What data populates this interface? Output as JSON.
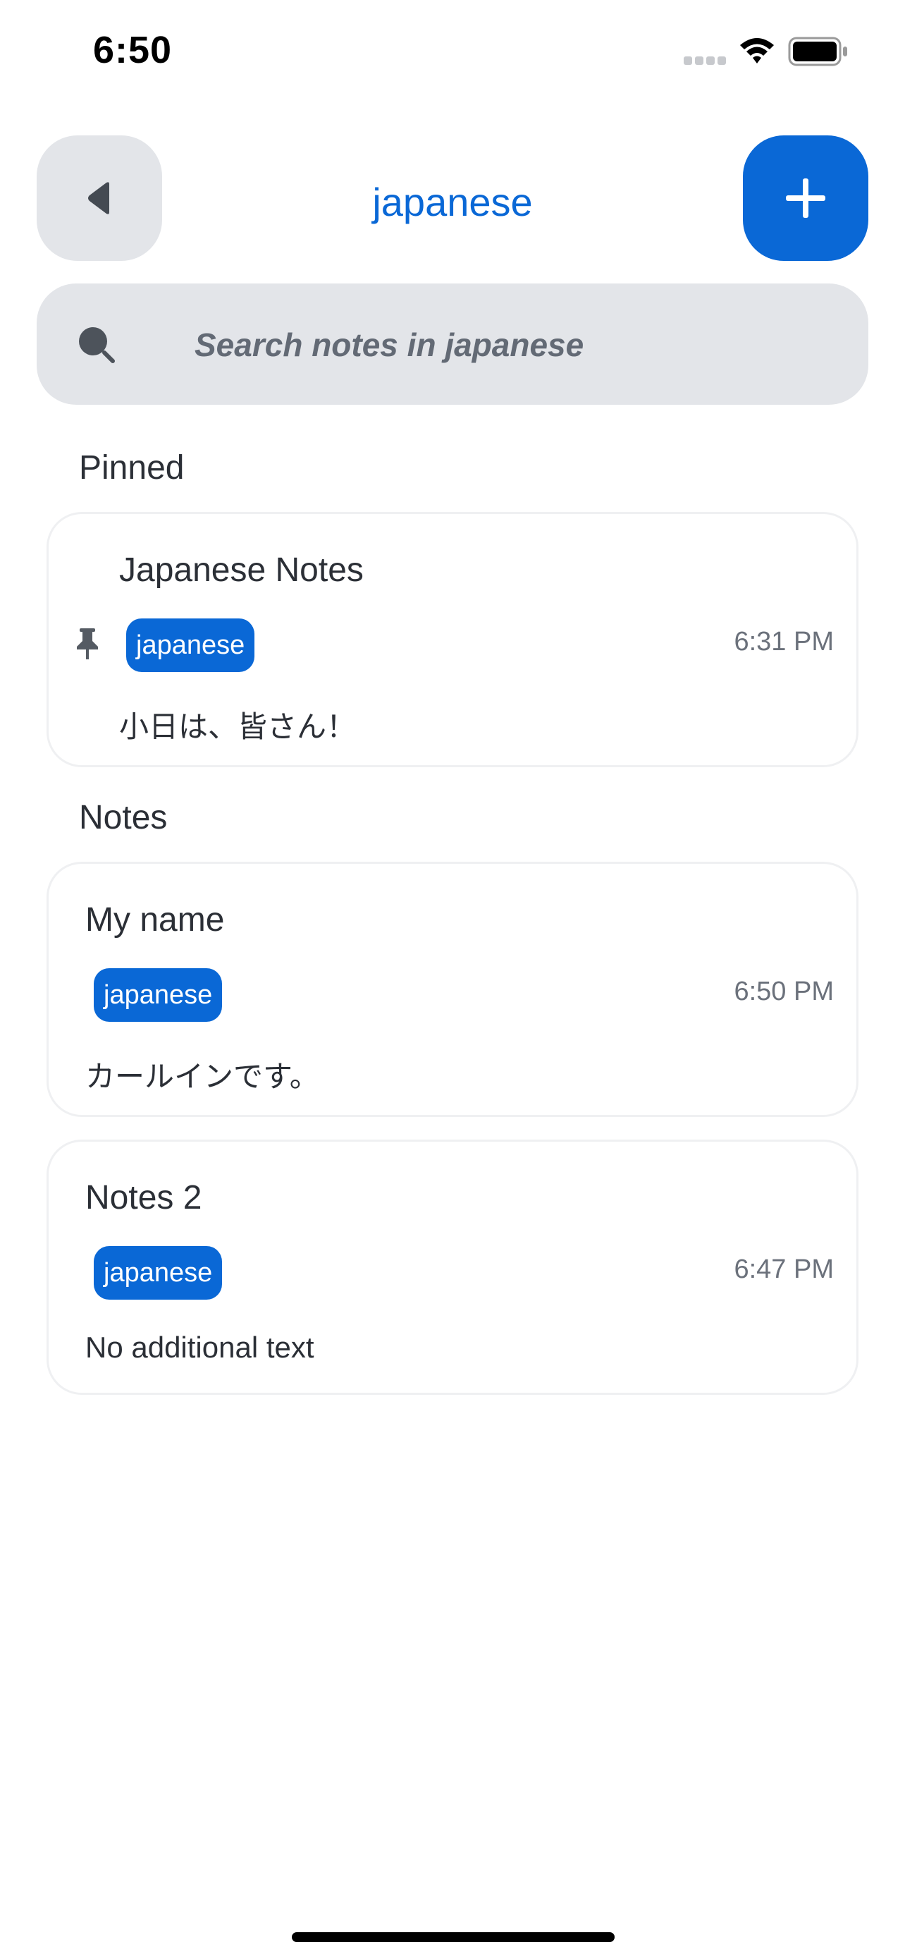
{
  "status_bar": {
    "time": "6:50"
  },
  "header": {
    "title": "japanese",
    "back_icon": "back-triangle-icon",
    "add_icon": "plus-icon"
  },
  "search": {
    "placeholder": "Search notes in japanese",
    "value": ""
  },
  "sections": {
    "pinned_label": "Pinned",
    "notes_label": "Notes"
  },
  "pinned_notes": [
    {
      "title": "Japanese Notes",
      "tag": "japanese",
      "time": "6:31 PM",
      "body": "小日は、皆さん！",
      "pinned": true
    }
  ],
  "notes": [
    {
      "title": "My name",
      "tag": "japanese",
      "time": "6:50 PM",
      "body": "カールインです。"
    },
    {
      "title": "Notes 2",
      "tag": "japanese",
      "time": "6:47 PM",
      "body": "No additional text"
    }
  ],
  "colors": {
    "accent": "#0a68d6",
    "surface": "#e3e5e9",
    "text": "#2b2f36",
    "muted": "#6b717b"
  }
}
